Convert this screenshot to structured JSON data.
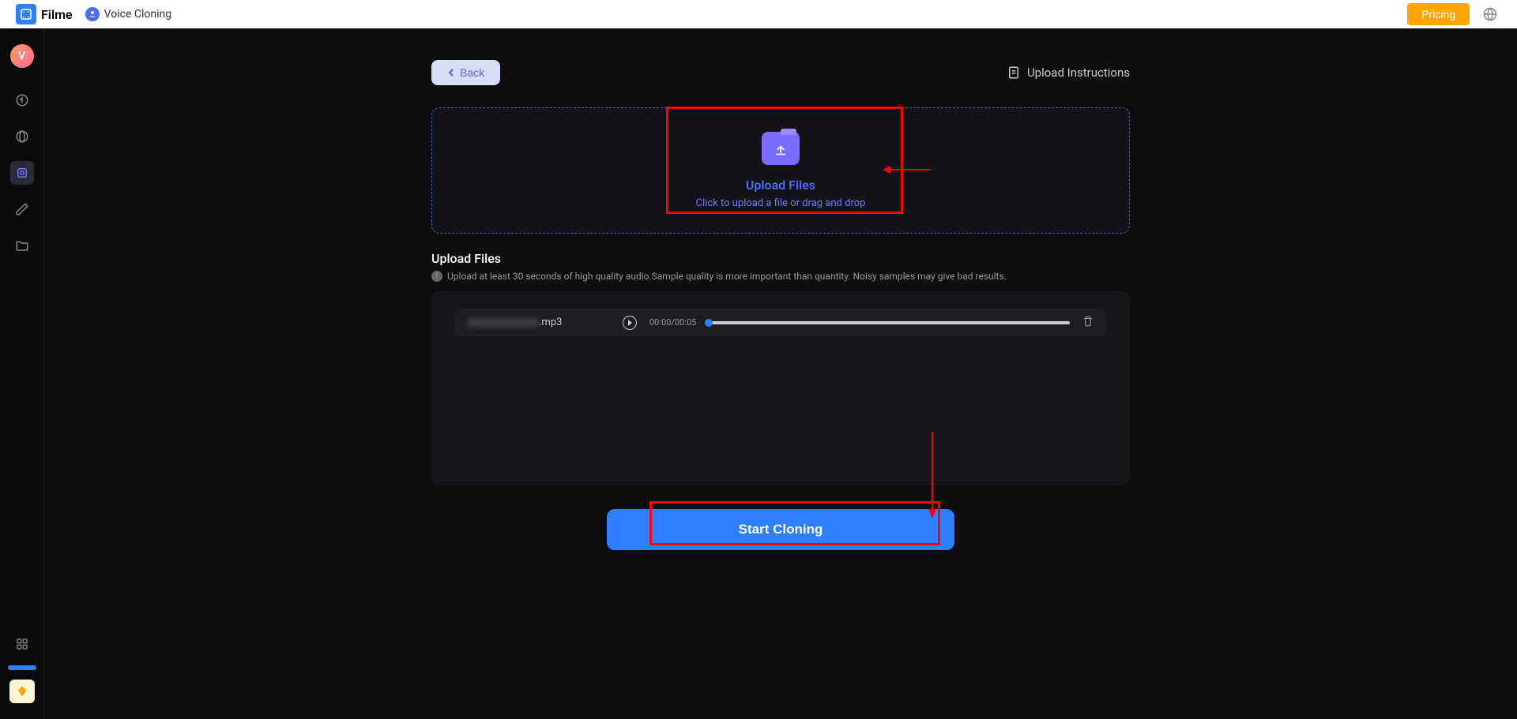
{
  "header": {
    "app_name": "Filme",
    "page_title": "Voice Cloning",
    "pricing_label": "Pricing"
  },
  "sidebar": {
    "avatar_letter": "V"
  },
  "content": {
    "back_label": "Back",
    "upload_instructions_label": "Upload Instructions",
    "dropzone": {
      "title": "Upload Files",
      "subtitle": "Click to upload a file or drag and drop"
    },
    "section_title": "Upload Files",
    "hint": "Upload at least 30 seconds of high quality audio.Sample quality is more important than quantity. Noisy samples may give bad results.",
    "file": {
      "extension": ".mp3",
      "time": "00:00/00:05"
    },
    "start_button": "Start Cloning"
  }
}
